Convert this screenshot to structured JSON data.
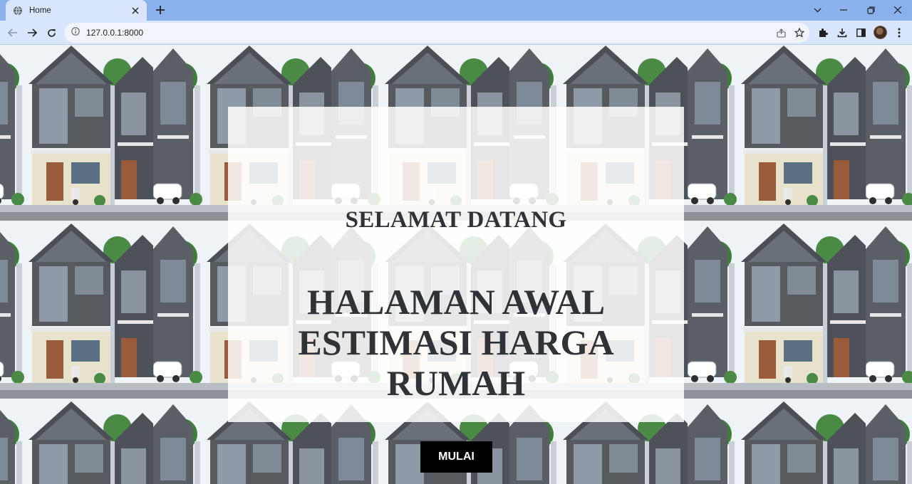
{
  "browser": {
    "tab": {
      "title": "Home",
      "favicon": "globe-icon"
    },
    "address": {
      "url": "127.0.0.1:8000",
      "site_info_icon": "info-icon"
    },
    "colors": {
      "tabstrip": "#8bb1ec",
      "toolbar": "#d8e5fb"
    }
  },
  "page": {
    "greeting": "SELAMAT DATANG",
    "headline_lines": [
      "HALAMAN AWAL",
      "ESTIMASI HARGA",
      "RUMAH"
    ],
    "start_button": "MULAI",
    "background": "tiled-house-image",
    "colors": {
      "text": "#2f3338",
      "button_bg": "#000000",
      "button_text": "#ffffff"
    }
  }
}
